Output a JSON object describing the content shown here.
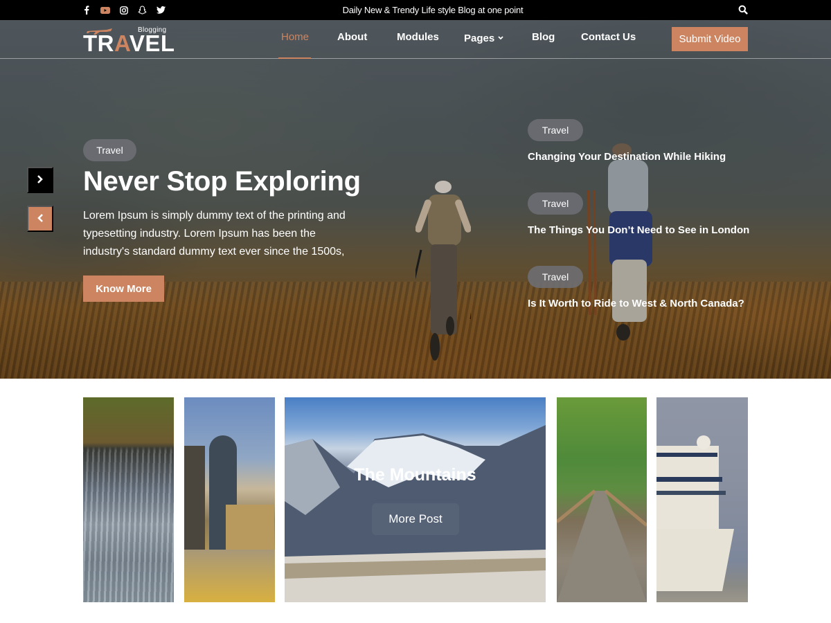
{
  "topbar": {
    "social": [
      {
        "icon": "facebook-icon",
        "label": "Facebook"
      },
      {
        "icon": "youtube-icon",
        "label": "YouTube"
      },
      {
        "icon": "instagram-icon",
        "label": "Instagram"
      },
      {
        "icon": "snapchat-icon",
        "label": "Snapchat"
      },
      {
        "icon": "twitter-icon",
        "label": "Twitter"
      }
    ],
    "tagline": "Daily New & Trendy Life style Blog at one point",
    "search_icon": "search-icon"
  },
  "logo": {
    "subtitle": "Blogging",
    "word_start": "TR",
    "word_accent": "A",
    "word_end": "VEL"
  },
  "nav": {
    "items": [
      {
        "label": "Home",
        "active": true
      },
      {
        "label": "About"
      },
      {
        "label": "Modules"
      },
      {
        "label": "Pages",
        "has_dropdown": true
      },
      {
        "label": "Blog"
      },
      {
        "label": "Contact Us"
      }
    ],
    "submit_label": "Submit Video"
  },
  "colors": {
    "accent": "#cc8560",
    "topbar": "#000000",
    "pill": "#6e7076"
  },
  "hero": {
    "category": "Travel",
    "title": "Never Stop Exploring",
    "description": "Lorem Ipsum is simply dummy text of the printing and typesetting industry. Lorem Ipsum has been the industry's standard dummy text ever since the 1500s,",
    "button_label": "Know More",
    "next_icon": "chevron-right-icon",
    "prev_icon": "chevron-left-icon"
  },
  "side_posts": [
    {
      "category": "Travel",
      "title": "Changing Your Destination While Hiking"
    },
    {
      "category": "Travel",
      "title": "The Things You Don’t Need to See in London"
    },
    {
      "category": "Travel",
      "title": "Is It Worth to Ride to West & North Canada?"
    }
  ],
  "gallery": {
    "images": [
      "waterfall",
      "city-skyline",
      "mountains",
      "forest-boardwalk",
      "cruise-ship"
    ],
    "featured_title": "The Mountains",
    "featured_button": "More Post"
  }
}
